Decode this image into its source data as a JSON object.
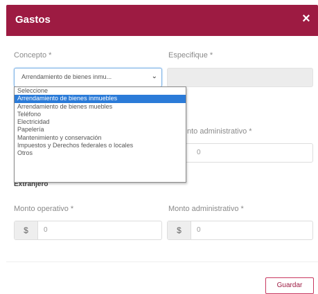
{
  "modal": {
    "title": "Gastos",
    "close_label": "×"
  },
  "concepto": {
    "label": "Concepto *",
    "selected_value": "Arrendamiento de bienes inmu...",
    "chevron": "⌄",
    "options": [
      "Seleccione",
      "Arrendamiento de bienes inmuebles",
      "Arrendamiento de bienes muebles",
      "Teléfono",
      "Electricidad",
      "Papelería",
      "Mantenimiento y conservación",
      "Impuestos y Derechos federales o locales",
      "Otros"
    ],
    "highlighted_index": 1
  },
  "especifique": {
    "label": "Especifique *"
  },
  "nacional": {
    "admin_label": "nto administrativo *",
    "admin_value": "0"
  },
  "extranjero": {
    "section_title": "Extranjero",
    "operativo_label": "Monto operativo *",
    "operativo_prefix": "$",
    "operativo_value": "0",
    "admin_label": "Monto administrativo *",
    "admin_prefix": "$",
    "admin_value": "0"
  },
  "footer": {
    "save_label": "Guardar"
  },
  "colors": {
    "header_bg": "#9d1b42",
    "selected_option_bg": "#2b7bd8"
  }
}
